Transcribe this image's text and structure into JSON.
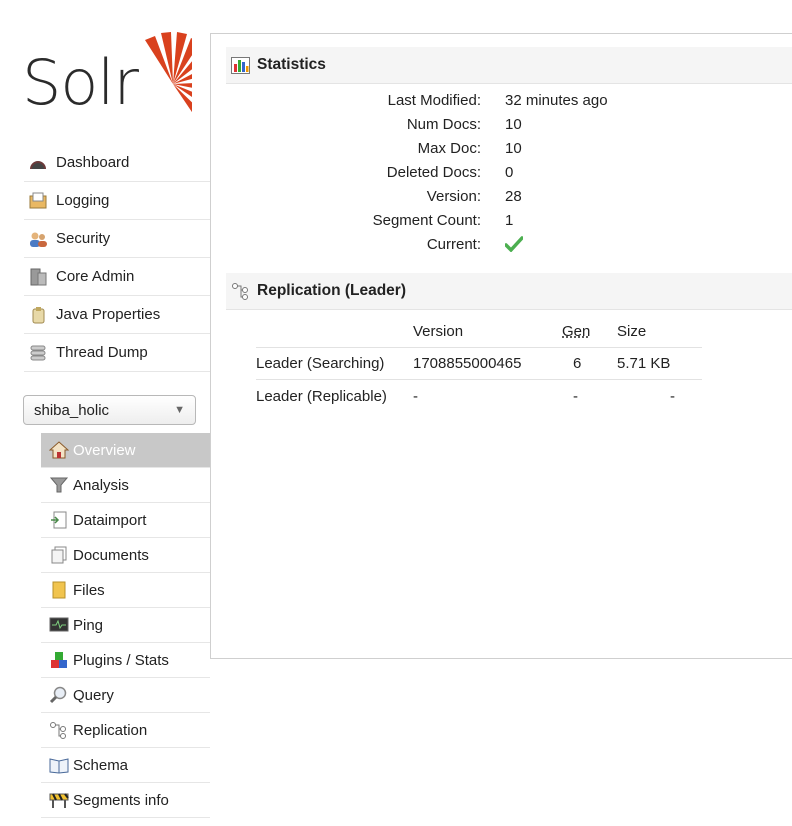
{
  "logo": {
    "text": "Solr"
  },
  "nav": [
    {
      "label": "Dashboard",
      "icon": "dashboard-icon"
    },
    {
      "label": "Logging",
      "icon": "logging-icon"
    },
    {
      "label": "Security",
      "icon": "security-icon"
    },
    {
      "label": "Core Admin",
      "icon": "core-admin-icon"
    },
    {
      "label": "Java Properties",
      "icon": "java-properties-icon"
    },
    {
      "label": "Thread Dump",
      "icon": "thread-dump-icon"
    }
  ],
  "core_selector": {
    "value": "shiba_holic"
  },
  "core_nav": [
    {
      "label": "Overview",
      "icon": "home-icon"
    },
    {
      "label": "Analysis",
      "icon": "funnel-icon"
    },
    {
      "label": "Dataimport",
      "icon": "dataimport-icon"
    },
    {
      "label": "Documents",
      "icon": "documents-icon"
    },
    {
      "label": "Files",
      "icon": "files-icon"
    },
    {
      "label": "Ping",
      "icon": "ping-icon"
    },
    {
      "label": "Plugins / Stats",
      "icon": "plugins-icon"
    },
    {
      "label": "Query",
      "icon": "magnifier-icon"
    },
    {
      "label": "Replication",
      "icon": "replication-icon"
    },
    {
      "label": "Schema",
      "icon": "schema-icon"
    },
    {
      "label": "Segments info",
      "icon": "segments-icon"
    }
  ],
  "statistics": {
    "title": "Statistics",
    "rows": [
      {
        "label": "Last Modified:",
        "value": "32 minutes ago"
      },
      {
        "label": "Num Docs:",
        "value": "10"
      },
      {
        "label": "Max Doc:",
        "value": "10"
      },
      {
        "label": "Deleted Docs:",
        "value": "0"
      },
      {
        "label": "Version:",
        "value": "28"
      },
      {
        "label": "Segment Count:",
        "value": "1"
      },
      {
        "label": "Current:",
        "value": ""
      }
    ]
  },
  "replication": {
    "title": "Replication (Leader)",
    "headers": {
      "version": "Version",
      "gen": "Gen",
      "size": "Size"
    },
    "rows": [
      {
        "name": "Leader (Searching)",
        "version": "1708855000465",
        "gen": "6",
        "size": "5.71 KB"
      },
      {
        "name": "Leader (Replicable)",
        "version": "-",
        "gen": "-",
        "size": "-"
      }
    ]
  },
  "colors": {
    "brand": "#d9411e",
    "check": "#4caf50",
    "active_bg": "#c8c8c8"
  }
}
